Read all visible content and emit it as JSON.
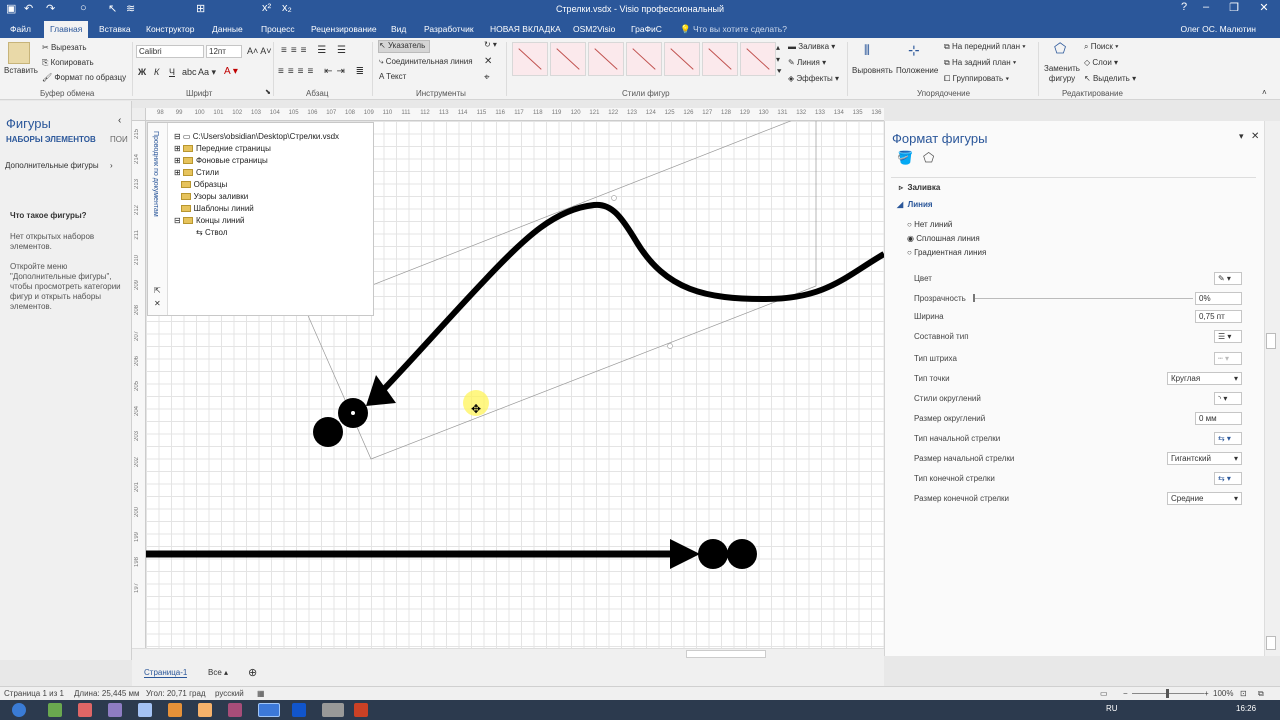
{
  "window": {
    "title": "Стрелки.vsdx - Visio профессиональный",
    "user": "Олег ОС. Малютин"
  },
  "tabs": [
    "Файл",
    "Главная",
    "Вставка",
    "Конструктор",
    "Данные",
    "Процесс",
    "Рецензирование",
    "Вид",
    "Разработчик",
    "НОВАЯ ВКЛАДКА",
    "OSM2Visio",
    "ГраФиС"
  ],
  "tell_me": "Что вы хотите сделать?",
  "ribbon": {
    "paste": "Вставить",
    "cut": "Вырезать",
    "copy": "Копировать",
    "format_painter": "Формат по образцу",
    "font_name": "Calibri",
    "font_size": "12пт",
    "pointer": "Указатель",
    "connector": "Соединительная линия",
    "text": "Текст",
    "fill": "Заливка",
    "line": "Линия",
    "effects": "Эффекты",
    "align": "Выровнять",
    "position": "Положение",
    "bring_front": "На передний план",
    "send_back": "На задний план",
    "group": "Группировать",
    "change_shape": "Заменить фигуру",
    "find": "Поиск",
    "layers": "Слои",
    "select": "Выделить",
    "groups": {
      "clipboard": "Буфер обмена",
      "font": "Шрифт",
      "paragraph": "Абзац",
      "tools": "Инструменты",
      "shape_styles": "Стили фигур",
      "arrange": "Упорядочение",
      "editing": "Редактирование"
    }
  },
  "shapes_pane": {
    "title": "Фигуры",
    "tab_sets": "НАБОРЫ ЭЛЕМЕНТОВ",
    "tab_search": "ПОИ",
    "more": "Дополнительные фигуры",
    "what_title": "Что такое фигуры?",
    "p1": "Нет открытых наборов элементов.",
    "p2": "Откройте меню \"Дополнительные фигуры\", чтобы просмотреть категории фигур и открыть наборы элементов."
  },
  "explorer": {
    "side_label": "Проводник по документам",
    "root": "C:\\Users\\obsidian\\Desktop\\Стрелки.vsdx",
    "items": [
      "Передние страницы",
      "Фоновые страницы",
      "Стили",
      "Образцы",
      "Узоры заливки",
      "Шаблоны линий",
      "Концы линий"
    ],
    "child": "Ствол"
  },
  "ruler": {
    "h": [
      "98",
      "99",
      "100",
      "101",
      "102",
      "103",
      "104",
      "105",
      "106",
      "107",
      "108",
      "109",
      "110",
      "111",
      "112",
      "113",
      "114",
      "115",
      "116",
      "117",
      "118",
      "119",
      "120",
      "121",
      "122",
      "123",
      "124",
      "125",
      "126",
      "127",
      "128",
      "129",
      "130",
      "131",
      "132",
      "133",
      "134",
      "135",
      "136"
    ],
    "v": [
      "215",
      "214",
      "213",
      "212",
      "211",
      "210",
      "209",
      "208",
      "207",
      "206",
      "205",
      "204",
      "203",
      "202",
      "201",
      "200",
      "199",
      "198",
      "197"
    ]
  },
  "format_pane": {
    "title": "Формат фигуры",
    "fill": "Заливка",
    "line": "Линия",
    "no_line": "Нет линий",
    "solid": "Сплошная линия",
    "gradient": "Градиентная линия",
    "color": "Цвет",
    "transparency": "Прозрачность",
    "transparency_val": "0%",
    "width": "Ширина",
    "width_val": "0,75 пт",
    "compound": "Составной тип",
    "dash": "Тип штриха",
    "cap": "Тип точки",
    "cap_val": "Круглая",
    "round_style": "Стили округлений",
    "round_size": "Размер округлений",
    "round_size_val": "0 мм",
    "begin_type": "Тип начальной стрелки",
    "begin_size": "Размер начальной стрелки",
    "begin_size_val": "Гигантский",
    "end_type": "Тип конечной стрелки",
    "end_size": "Размер конечной стрелки",
    "end_size_val": "Средние"
  },
  "page_tabs": {
    "page": "Страница-1",
    "all": "Все"
  },
  "status": {
    "page": "Страница 1 из 1",
    "length": "Длина: 25,445 мм",
    "angle": "Угол: 20,71 град",
    "lang": "русский",
    "zoom": "100%",
    "kbd": "RU",
    "time": "16:26"
  },
  "colors": {
    "accent": "#2b579a",
    "ribbon": "#f3f3f3"
  }
}
